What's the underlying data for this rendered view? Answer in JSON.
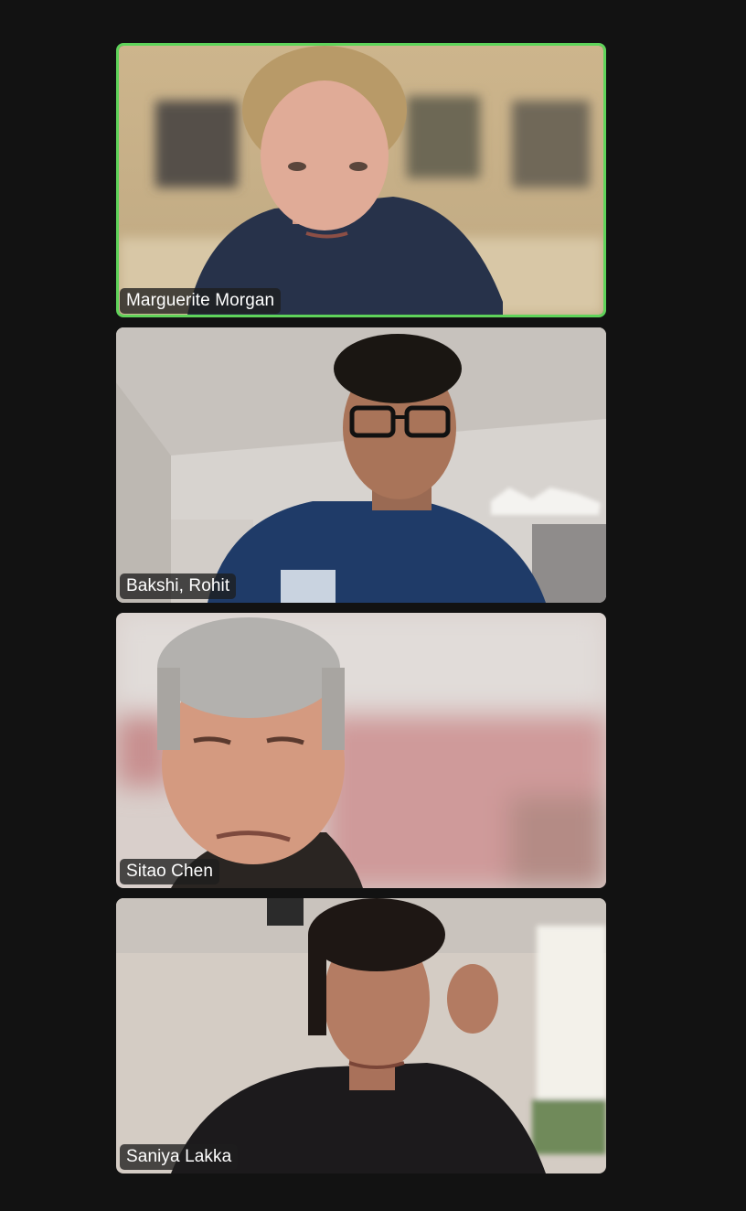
{
  "window": {
    "background": "#121212",
    "active_speaker_border": "#5fd35a"
  },
  "participants": [
    {
      "name": "Marguerite Morgan",
      "active_speaker": true,
      "video": "person-video"
    },
    {
      "name": "Bakshi, Rohit",
      "active_speaker": false,
      "video": "person-video"
    },
    {
      "name": "Sitao Chen",
      "active_speaker": false,
      "video": "person-video"
    },
    {
      "name": "Saniya Lakka",
      "active_speaker": false,
      "video": "person-video"
    }
  ]
}
